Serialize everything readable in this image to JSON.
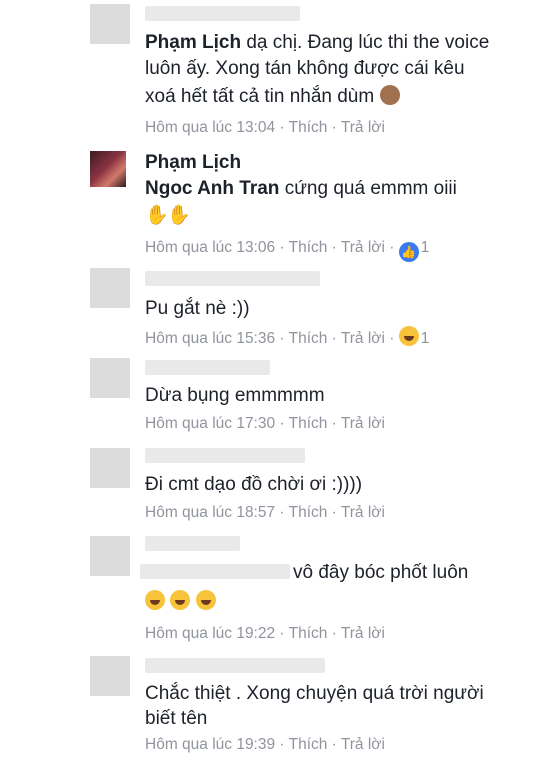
{
  "meta": {
    "like_label": "Thích",
    "reply_label": "Trả lời",
    "separator": " · "
  },
  "comments": [
    {
      "author": "Phạm Lịch",
      "lines": [
        "dạ chị. Đang lúc thi the voice",
        "luôn ấy. Xong tán không được cái kêu",
        "xoá hết tất cả tin nhắn dùm"
      ],
      "time": "Hôm qua lúc 13:04"
    },
    {
      "author": "Phạm Lịch",
      "tag": "Ngoc Anh Tran",
      "lines": [
        "cứng quá emmm oiii"
      ],
      "time": "Hôm qua lúc 13:06",
      "reaction_count": "1"
    },
    {
      "lines": [
        "Pu gắt nè :))"
      ],
      "time": "Hôm qua lúc 15:36",
      "reaction_count": "1"
    },
    {
      "lines": [
        "Dừa bụng emmmmm"
      ],
      "time": "Hôm qua lúc 17:30"
    },
    {
      "lines": [
        "Đi cmt dạo đồ chời ơi :))))"
      ],
      "time": "Hôm qua lúc 18:57"
    },
    {
      "lines": [
        "vô đây bóc phốt luôn"
      ],
      "time": "Hôm qua lúc 19:22"
    },
    {
      "lines": [
        "Chắc thiệt . Xong chuyện quá trời người",
        "biết tên"
      ],
      "time": "Hôm qua lúc 19:39"
    }
  ],
  "colors": {
    "meta": "#90949c",
    "name": "#1d2129",
    "like_reaction": "#3b7bf0",
    "haha_reaction": "#f6c33a"
  },
  "icons": [
    "see-no-evil-monkey-icon",
    "clapping-hands-icon",
    "like-reaction-icon",
    "haha-reaction-icon",
    "laughing-crying-icon"
  ]
}
